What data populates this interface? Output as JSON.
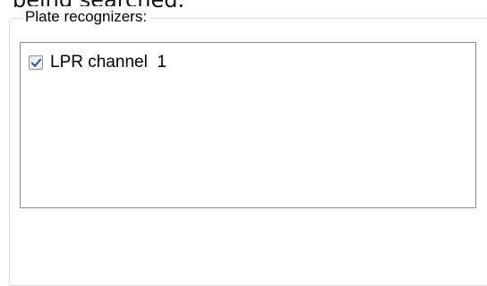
{
  "top_text": "being searched.",
  "group": {
    "caption": "Plate recognizers:"
  },
  "recognizers": [
    {
      "label": "LPR channel  1",
      "checked": true
    }
  ],
  "colors": {
    "group_border": "#d5dfe5",
    "list_border": "#828790",
    "checkmark": "#2f5f9e"
  }
}
